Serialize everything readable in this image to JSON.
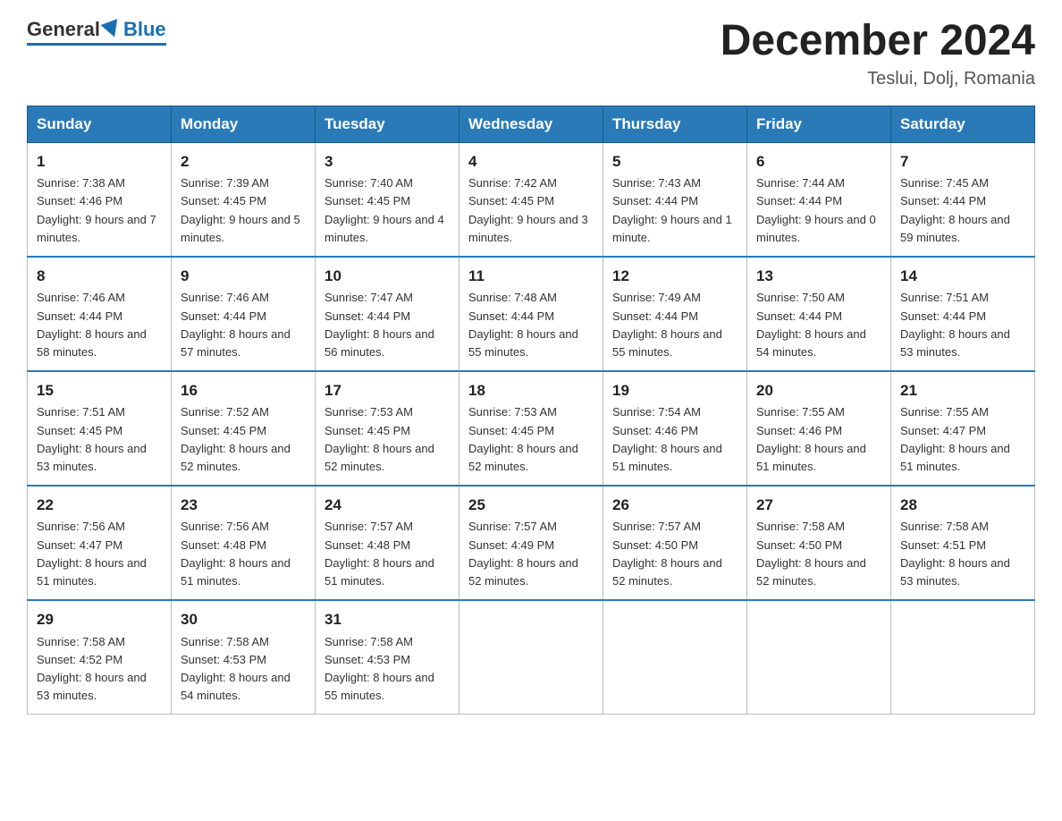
{
  "header": {
    "logo_general": "General",
    "logo_blue": "Blue",
    "month_title": "December 2024",
    "location": "Teslui, Dolj, Romania"
  },
  "days_of_week": [
    "Sunday",
    "Monday",
    "Tuesday",
    "Wednesday",
    "Thursday",
    "Friday",
    "Saturday"
  ],
  "weeks": [
    [
      {
        "day": "1",
        "sunrise": "7:38 AM",
        "sunset": "4:46 PM",
        "daylight": "9 hours and 7 minutes."
      },
      {
        "day": "2",
        "sunrise": "7:39 AM",
        "sunset": "4:45 PM",
        "daylight": "9 hours and 5 minutes."
      },
      {
        "day": "3",
        "sunrise": "7:40 AM",
        "sunset": "4:45 PM",
        "daylight": "9 hours and 4 minutes."
      },
      {
        "day": "4",
        "sunrise": "7:42 AM",
        "sunset": "4:45 PM",
        "daylight": "9 hours and 3 minutes."
      },
      {
        "day": "5",
        "sunrise": "7:43 AM",
        "sunset": "4:44 PM",
        "daylight": "9 hours and 1 minute."
      },
      {
        "day": "6",
        "sunrise": "7:44 AM",
        "sunset": "4:44 PM",
        "daylight": "9 hours and 0 minutes."
      },
      {
        "day": "7",
        "sunrise": "7:45 AM",
        "sunset": "4:44 PM",
        "daylight": "8 hours and 59 minutes."
      }
    ],
    [
      {
        "day": "8",
        "sunrise": "7:46 AM",
        "sunset": "4:44 PM",
        "daylight": "8 hours and 58 minutes."
      },
      {
        "day": "9",
        "sunrise": "7:46 AM",
        "sunset": "4:44 PM",
        "daylight": "8 hours and 57 minutes."
      },
      {
        "day": "10",
        "sunrise": "7:47 AM",
        "sunset": "4:44 PM",
        "daylight": "8 hours and 56 minutes."
      },
      {
        "day": "11",
        "sunrise": "7:48 AM",
        "sunset": "4:44 PM",
        "daylight": "8 hours and 55 minutes."
      },
      {
        "day": "12",
        "sunrise": "7:49 AM",
        "sunset": "4:44 PM",
        "daylight": "8 hours and 55 minutes."
      },
      {
        "day": "13",
        "sunrise": "7:50 AM",
        "sunset": "4:44 PM",
        "daylight": "8 hours and 54 minutes."
      },
      {
        "day": "14",
        "sunrise": "7:51 AM",
        "sunset": "4:44 PM",
        "daylight": "8 hours and 53 minutes."
      }
    ],
    [
      {
        "day": "15",
        "sunrise": "7:51 AM",
        "sunset": "4:45 PM",
        "daylight": "8 hours and 53 minutes."
      },
      {
        "day": "16",
        "sunrise": "7:52 AM",
        "sunset": "4:45 PM",
        "daylight": "8 hours and 52 minutes."
      },
      {
        "day": "17",
        "sunrise": "7:53 AM",
        "sunset": "4:45 PM",
        "daylight": "8 hours and 52 minutes."
      },
      {
        "day": "18",
        "sunrise": "7:53 AM",
        "sunset": "4:45 PM",
        "daylight": "8 hours and 52 minutes."
      },
      {
        "day": "19",
        "sunrise": "7:54 AM",
        "sunset": "4:46 PM",
        "daylight": "8 hours and 51 minutes."
      },
      {
        "day": "20",
        "sunrise": "7:55 AM",
        "sunset": "4:46 PM",
        "daylight": "8 hours and 51 minutes."
      },
      {
        "day": "21",
        "sunrise": "7:55 AM",
        "sunset": "4:47 PM",
        "daylight": "8 hours and 51 minutes."
      }
    ],
    [
      {
        "day": "22",
        "sunrise": "7:56 AM",
        "sunset": "4:47 PM",
        "daylight": "8 hours and 51 minutes."
      },
      {
        "day": "23",
        "sunrise": "7:56 AM",
        "sunset": "4:48 PM",
        "daylight": "8 hours and 51 minutes."
      },
      {
        "day": "24",
        "sunrise": "7:57 AM",
        "sunset": "4:48 PM",
        "daylight": "8 hours and 51 minutes."
      },
      {
        "day": "25",
        "sunrise": "7:57 AM",
        "sunset": "4:49 PM",
        "daylight": "8 hours and 52 minutes."
      },
      {
        "day": "26",
        "sunrise": "7:57 AM",
        "sunset": "4:50 PM",
        "daylight": "8 hours and 52 minutes."
      },
      {
        "day": "27",
        "sunrise": "7:58 AM",
        "sunset": "4:50 PM",
        "daylight": "8 hours and 52 minutes."
      },
      {
        "day": "28",
        "sunrise": "7:58 AM",
        "sunset": "4:51 PM",
        "daylight": "8 hours and 53 minutes."
      }
    ],
    [
      {
        "day": "29",
        "sunrise": "7:58 AM",
        "sunset": "4:52 PM",
        "daylight": "8 hours and 53 minutes."
      },
      {
        "day": "30",
        "sunrise": "7:58 AM",
        "sunset": "4:53 PM",
        "daylight": "8 hours and 54 minutes."
      },
      {
        "day": "31",
        "sunrise": "7:58 AM",
        "sunset": "4:53 PM",
        "daylight": "8 hours and 55 minutes."
      },
      null,
      null,
      null,
      null
    ]
  ]
}
